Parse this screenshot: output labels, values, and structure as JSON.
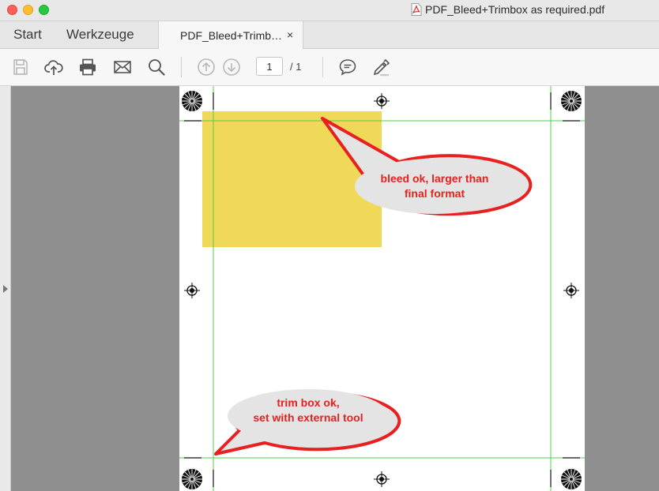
{
  "window": {
    "title": "PDF_Bleed+Trimbox as required.pdf"
  },
  "tabs": {
    "home_label": "Start",
    "tools_label": "Werkzeuge",
    "document_label": "PDF_Bleed+Trimb…",
    "close_symbol": "×"
  },
  "toolbar": {
    "current_page": "1",
    "page_total": "/ 1"
  },
  "document": {
    "callout_bleed_line1": "bleed ok, larger than",
    "callout_bleed_line2": "final format",
    "callout_trim_line1": "trim box ok,",
    "callout_trim_line2": "set with external tool"
  },
  "colors": {
    "trim_line": "#4ad04a",
    "yellow_box": "#f0d858",
    "callout_border": "#e82020",
    "callout_fill": "#e4e4e4",
    "callout_text": "#e82020"
  }
}
